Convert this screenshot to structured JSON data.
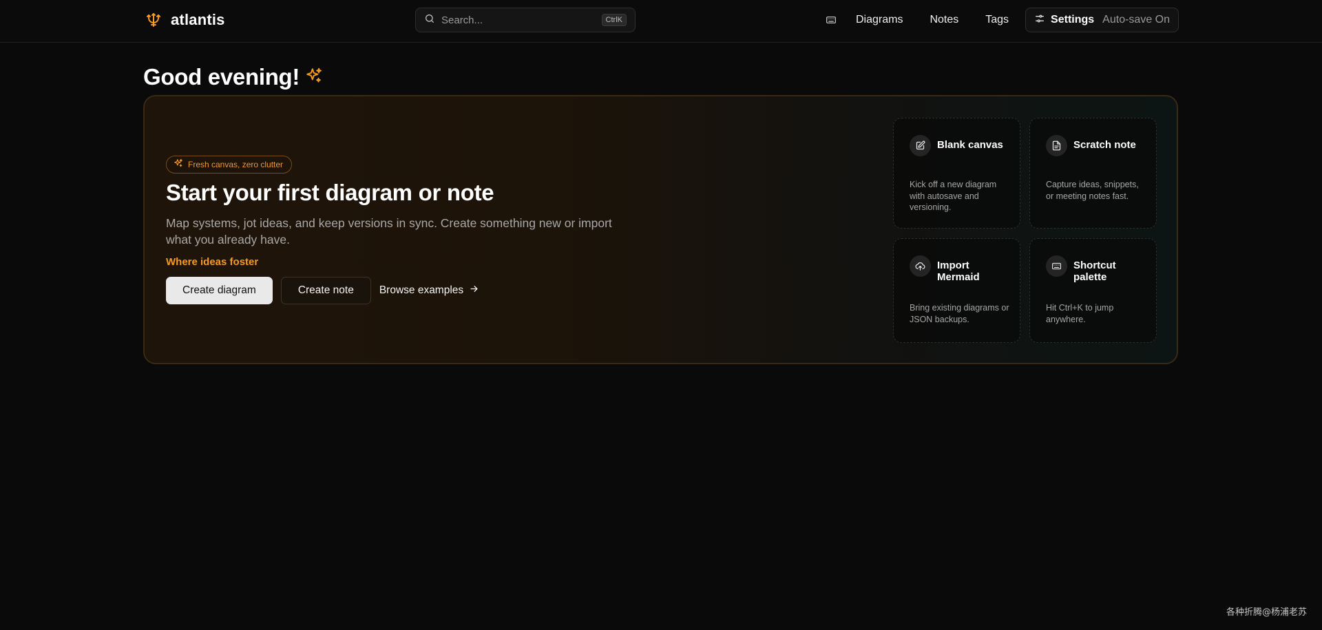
{
  "brand": {
    "name": "atlantis",
    "accent": "#f59a22"
  },
  "search": {
    "placeholder": "Search...",
    "shortcut": "CtrlK"
  },
  "nav": {
    "keyboard_icon": "keyboard-icon",
    "links": [
      "Diagrams",
      "Notes",
      "Tags"
    ],
    "settings_label": "Settings",
    "autosave_status": "Auto-save On"
  },
  "greeting": {
    "text": "Good evening!",
    "icon": "sparkles-icon"
  },
  "hero": {
    "pill": "Fresh canvas, zero clutter",
    "title": "Start your first diagram or note",
    "description": "Map systems, jot ideas, and keep versions in sync. Create something new or import what you already have.",
    "tagline": "Where ideas foster",
    "primary_button": "Create diagram",
    "secondary_button": "Create note",
    "link_button": "Browse examples"
  },
  "cards": [
    {
      "icon": "pencil-square-icon",
      "title": "Blank canvas",
      "body": "Kick off a new diagram with autosave and versioning."
    },
    {
      "icon": "document-icon",
      "title": "Scratch note",
      "body": "Capture ideas, snippets, or meeting notes fast."
    },
    {
      "icon": "cloud-upload-icon",
      "title": "Import Mermaid",
      "body": "Bring existing diagrams or JSON backups."
    },
    {
      "icon": "keyboard-icon",
      "title": "Shortcut palette",
      "body": "Hit Ctrl+K to jump anywhere."
    }
  ],
  "watermark": "各种折腾@杨浦老苏"
}
